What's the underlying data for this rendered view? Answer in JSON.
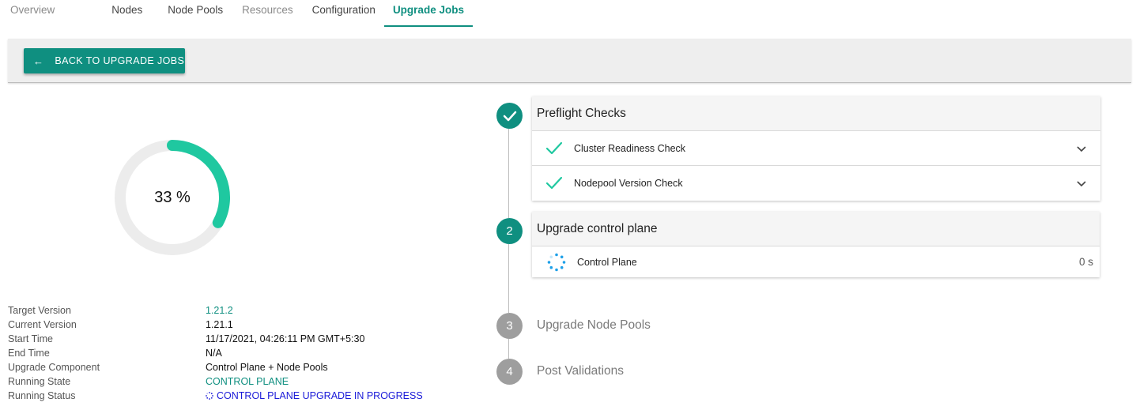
{
  "tabs": [
    {
      "label": "Overview",
      "state": "muted"
    },
    {
      "label": "Nodes",
      "state": "normal"
    },
    {
      "label": "Node Pools",
      "state": "normal"
    },
    {
      "label": "Resources",
      "state": "muted"
    },
    {
      "label": "Configuration",
      "state": "normal"
    },
    {
      "label": "Upgrade Jobs",
      "state": "active"
    }
  ],
  "back_button": {
    "arrow": "←",
    "label": "BACK TO UPGRADE JOBS"
  },
  "progress": {
    "percent": 33,
    "label": "33 %"
  },
  "details": [
    {
      "key": "Target Version",
      "value": "1.21.2",
      "style": "teal"
    },
    {
      "key": "Current Version",
      "value": "1.21.1",
      "style": "plain"
    },
    {
      "key": "Start Time",
      "value": "11/17/2021, 04:26:11 PM GMT+5:30",
      "style": "plain"
    },
    {
      "key": "End Time",
      "value": "N/A",
      "style": "plain"
    },
    {
      "key": "Upgrade Component",
      "value": "Control Plane + Node Pools",
      "style": "plain"
    },
    {
      "key": "Running State",
      "value": "CONTROL PLANE",
      "style": "teal"
    },
    {
      "key": "Running Status",
      "value": "CONTROL PLANE UPGRADE IN PROGRESS",
      "style": "blue"
    }
  ],
  "steps": [
    {
      "number": "",
      "status": "done",
      "title": "Preflight Checks",
      "items": [
        {
          "label": "Cluster Readiness Check",
          "icon": "check-icon"
        },
        {
          "label": "Nodepool Version Check",
          "icon": "check-icon"
        }
      ]
    },
    {
      "number": "2",
      "status": "current",
      "title": "Upgrade control plane",
      "items": [
        {
          "label": "Control Plane",
          "icon": "spinner-icon",
          "duration": "0 s"
        }
      ]
    },
    {
      "number": "3",
      "status": "pending",
      "title": "Upgrade Node Pools"
    },
    {
      "number": "4",
      "status": "pending",
      "title": "Post Validations"
    }
  ],
  "colors": {
    "accent": "#0f8f80",
    "progress": "#1fc8a0",
    "track": "#ececec",
    "pending": "#9e9e9e",
    "status_blue": "#1a1ad8",
    "spinner": "#1ea0e8"
  }
}
